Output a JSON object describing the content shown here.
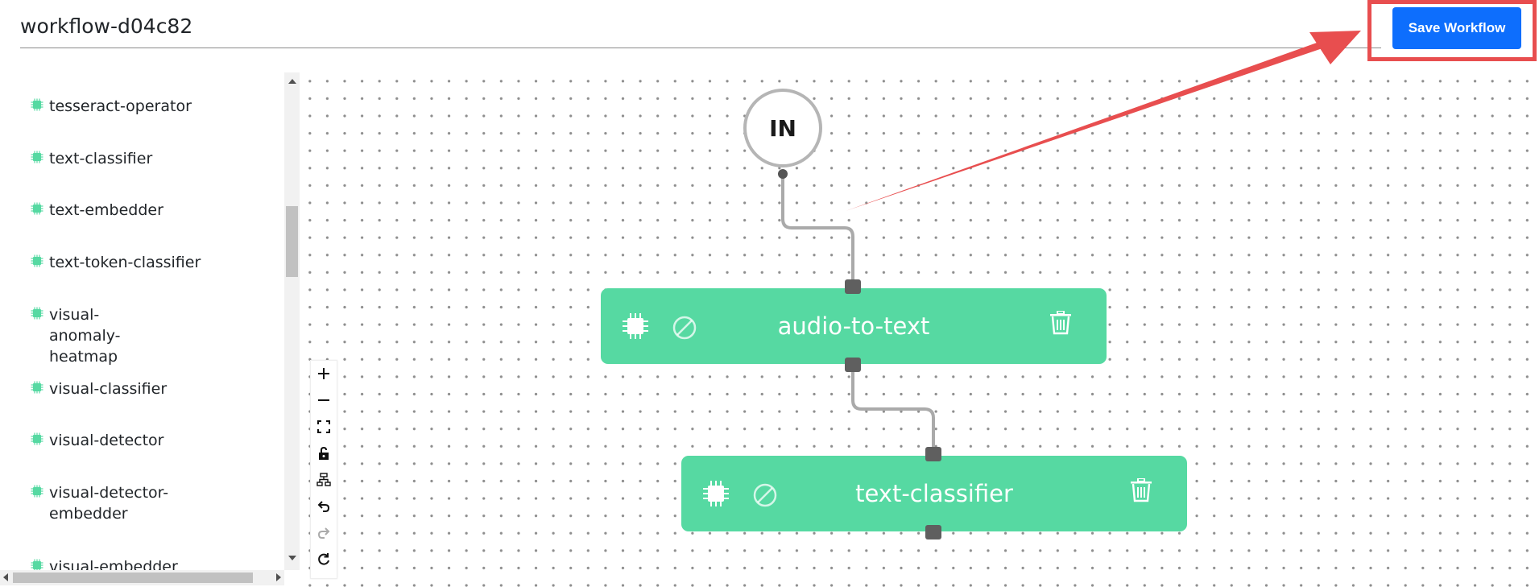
{
  "header": {
    "workflow_name": "workflow-d04c82",
    "save_label": "Save Workflow"
  },
  "colors": {
    "node_green": "#56d9a2",
    "primary_button": "#0d6efd",
    "highlight_red": "#e84e4f"
  },
  "sidebar": {
    "items": [
      {
        "label": "tesseract-operator",
        "icon": "chip-icon"
      },
      {
        "label": "text-classifier",
        "icon": "chip-icon"
      },
      {
        "label": "text-embedder",
        "icon": "chip-icon"
      },
      {
        "label": "text-token-classifier",
        "icon": "chip-icon"
      },
      {
        "label": "visual-anomaly-heatmap",
        "icon": "chip-icon"
      },
      {
        "label": "visual-classifier",
        "icon": "chip-icon"
      },
      {
        "label": "visual-detector",
        "icon": "chip-icon"
      },
      {
        "label": "visual-detector-embedder",
        "icon": "chip-icon"
      },
      {
        "label": "visual-embedder",
        "icon": "chip-icon"
      }
    ]
  },
  "canvas": {
    "input_node": {
      "label": "IN"
    },
    "nodes": [
      {
        "label": "audio-to-text"
      },
      {
        "label": "text-classifier"
      }
    ],
    "edges": [
      {
        "from": "IN",
        "to": "audio-to-text"
      },
      {
        "from": "audio-to-text",
        "to": "text-classifier"
      }
    ]
  },
  "controls": [
    "zoom-in-icon",
    "zoom-out-icon",
    "fit-view-icon",
    "lock-icon",
    "auto-layout-icon",
    "undo-icon",
    "redo-icon",
    "reset-icon"
  ]
}
